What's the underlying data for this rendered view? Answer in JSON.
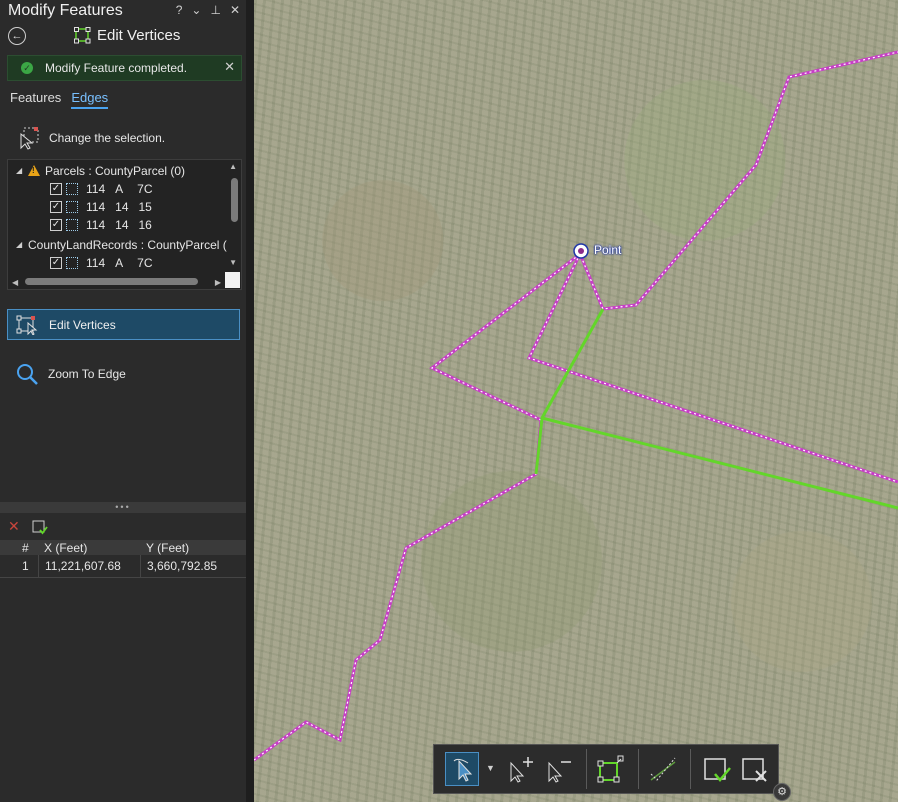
{
  "pane": {
    "title": "Modify Features",
    "title_controls": [
      "?",
      "⌄",
      "⊥",
      "✕"
    ],
    "tool_title": "Edit Vertices",
    "notice": "Modify Feature completed.",
    "tabs": [
      "Features",
      "Edges"
    ],
    "active_tab": "Edges",
    "change_selection": "Change the selection.",
    "tree": {
      "group1": "Parcels : CountyParcel (0)",
      "group1_items": [
        [
          "114",
          "A",
          "7C"
        ],
        [
          "114",
          "14",
          "15"
        ],
        [
          "114",
          "14",
          "16"
        ]
      ],
      "group2": "CountyLandRecords : CountyParcel (",
      "group2_items": [
        [
          "114",
          "A",
          "7C"
        ]
      ]
    },
    "edit_vertices_label": "Edit Vertices",
    "zoom_to_edge_label": "Zoom To Edge",
    "grid": {
      "headers": [
        "#",
        "X (Feet)",
        "Y (Feet)"
      ],
      "rows": [
        [
          "1",
          "11,221,607.68",
          "3,660,792.85"
        ]
      ]
    }
  },
  "map": {
    "point_label": "Point",
    "parcel_line_color": "#c83cc8",
    "edge_color": "#63d62a",
    "vertex_color": "#ffffff"
  },
  "toolbar": {
    "tools": [
      "select-vertex-icon",
      "add-vertex-icon",
      "delete-vertex-icon",
      "reshape-icon",
      "continue-feature-icon",
      "finish-icon",
      "cancel-icon"
    ],
    "gear": "⚙"
  }
}
